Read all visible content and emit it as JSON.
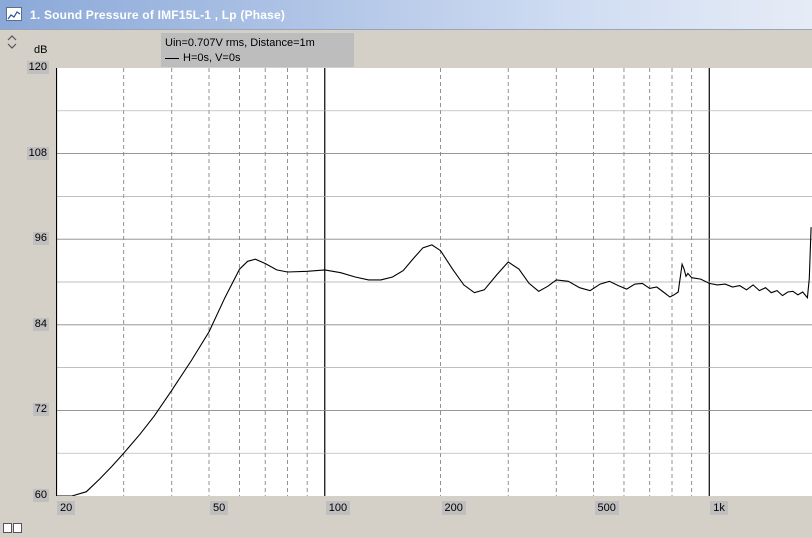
{
  "window": {
    "title": "1. Sound Pressure of IMF15L-1 , Lp (Phase)"
  },
  "legend": {
    "line1": "Uin=0.707V rms, Distance=1m",
    "line2": "H=0s, V=0s"
  },
  "chart_data": {
    "type": "line",
    "ylabel": "dB",
    "x_scale": "log",
    "xlim": [
      20,
      1850
    ],
    "ylim": [
      60,
      120
    ],
    "y_ticks": [
      "120",
      "108",
      "96",
      "84",
      "72",
      "60"
    ],
    "x_ticks": [
      "20",
      "50",
      "100",
      "200",
      "500",
      "1k"
    ],
    "series": [
      {
        "color": "#000000",
        "x": [
          20,
          22,
          24,
          26,
          28,
          30,
          33,
          36,
          40,
          45,
          50,
          55,
          60,
          63,
          66,
          70,
          75,
          80,
          90,
          100,
          110,
          120,
          130,
          140,
          150,
          160,
          170,
          180,
          190,
          200,
          215,
          230,
          245,
          260,
          280,
          300,
          320,
          340,
          360,
          380,
          400,
          430,
          460,
          490,
          520,
          550,
          580,
          610,
          640,
          670,
          700,
          730,
          760,
          790,
          810,
          830,
          850,
          860,
          870,
          880,
          900,
          950,
          1000,
          1050,
          1100,
          1150,
          1200,
          1250,
          1300,
          1350,
          1400,
          1450,
          1500,
          1550,
          1600,
          1650,
          1700,
          1750,
          1800,
          1820,
          1840
        ],
        "y": [
          60,
          60,
          60.6,
          62.4,
          64.2,
          66,
          68.6,
          71.2,
          74.8,
          79,
          83,
          87.8,
          91.8,
          92.9,
          93.2,
          92.6,
          91.7,
          91.4,
          91.5,
          91.7,
          91.3,
          90.7,
          90.3,
          90.3,
          90.7,
          91.6,
          93.3,
          94.8,
          95.2,
          94.4,
          91.8,
          89.6,
          88.5,
          88.9,
          91,
          92.8,
          91.8,
          89.8,
          88.7,
          89.4,
          90.3,
          90.1,
          89.2,
          88.8,
          89.7,
          90.1,
          89.5,
          89,
          89.7,
          89.8,
          89.1,
          89.3,
          88.6,
          87.9,
          88.2,
          88.6,
          92.5,
          91.8,
          90.8,
          91.2,
          90.6,
          90.4,
          89.8,
          89.6,
          89.7,
          89.3,
          89.5,
          88.9,
          89.6,
          88.8,
          89.2,
          88.5,
          88.8,
          88.1,
          88.6,
          88.7,
          88.2,
          88.6,
          87.8,
          90.5,
          97.7
        ]
      }
    ]
  }
}
